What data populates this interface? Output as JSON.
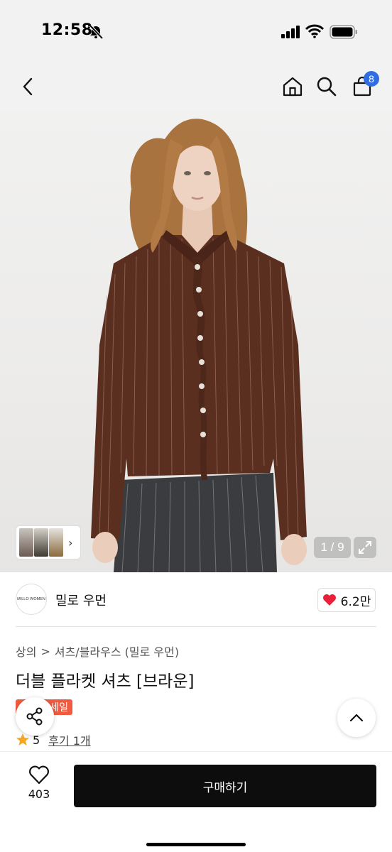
{
  "status": {
    "time": "12:58"
  },
  "nav": {
    "cart_count": "8"
  },
  "hero": {
    "counter": "1 / 9"
  },
  "brand": {
    "logo_text": "MILLO WOMEN",
    "name": "밀로 우먼",
    "likes": "6.2만"
  },
  "breadcrumb": {
    "category": "상의",
    "subcategory": "셔츠/블라우스 (밀로 우먼)",
    "separator": ">"
  },
  "product": {
    "title": "더블 플라켓 셔츠 [브라운]",
    "sale_label": "세일",
    "rating": "5",
    "reviews": "후기 1개"
  },
  "bottom": {
    "wish_count": "403",
    "buy_label": "구매하기"
  },
  "colors": {
    "accent_blue": "#2f6de1",
    "sale_red": "#f05a3e",
    "heart_red": "#e8203a",
    "star": "#f5a623",
    "buy_black": "#0d0d0d"
  }
}
